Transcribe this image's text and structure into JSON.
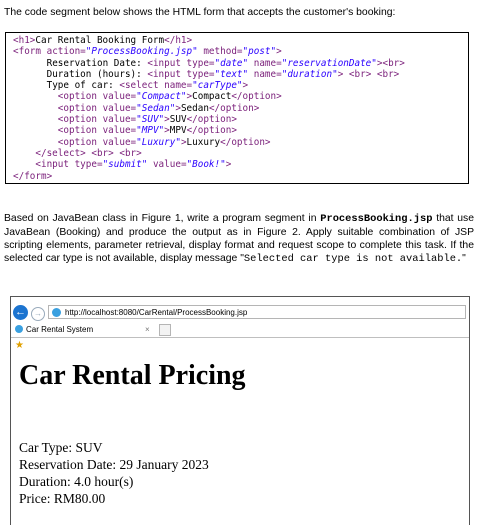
{
  "intro": "The code segment below shows the HTML form that accepts the customer's booking:",
  "code": {
    "line1": {
      "open": "<h1>",
      "text": "Car Rental Booking Form",
      "close": "</h1>"
    },
    "line2": {
      "form": "<form",
      "a1": " action=",
      "v1": "\"ProcessBooking.jsp\"",
      "a2": " method=",
      "v2": "\"post\"",
      "end": ">"
    },
    "line3": {
      "text": "Reservation Date: ",
      "tag": "<input",
      "a1": " type=",
      "v1": "\"date\"",
      "a2": " name=",
      "v2": "\"reservationDate\"",
      "end": "><br>"
    },
    "line4": {
      "text": "Duration (hours): ",
      "tag": "<input",
      "a1": " type=",
      "v1": "\"text\"",
      "a2": " name=",
      "v2": "\"duration\"",
      "end": "> <br> <br>"
    },
    "line5": {
      "text": "Type of car: ",
      "tag": "<select",
      "a1": " name=",
      "v1": "\"carType\"",
      "end": ">"
    },
    "options": [
      {
        "value": "\"Compact\"",
        "label": "Compact"
      },
      {
        "value": "\"Sedan\"",
        "label": "Sedan"
      },
      {
        "value": "\"SUV\"",
        "label": "SUV"
      },
      {
        "value": "\"MPV\"",
        "label": "MPV"
      },
      {
        "value": "\"Luxury\"",
        "label": "Luxury"
      }
    ],
    "line11": "</select> <br> <br>",
    "line12": {
      "tag": "<input",
      "a1": " type=",
      "v1": "\"submit\"",
      "a2": " value=",
      "v2": "\"Book!\"",
      "end": ">"
    },
    "line13": "</form>"
  },
  "task": {
    "p1": "Based on JavaBean class in Figure 1, write a program segment in",
    "file": "ProcessBooking.jsp",
    "p2": " that use JavaBean (Booking) and produce the output as in Figure 2. Apply suitable combination of JSP scripting elements, parameter retrieval, display format and request scope to complete this task. If the selected car type is not available, display message \"",
    "message": "Selected car type is not available.",
    "p3": "\""
  },
  "browser": {
    "url": "http://localhost:8080/CarRental/ProcessBooking.jsp",
    "tab_title": "Car Rental System",
    "tab_close": "×",
    "back_icon": "arrow-left-icon",
    "forward_icon": "arrow-right-icon",
    "favorites_icon": "star-icon",
    "heading": "Car Rental Pricing",
    "lines": [
      "Car Type: SUV",
      "Reservation Date: 29 January 2023",
      "Duration: 4.0 hour(s)",
      "Price: RM80.00"
    ]
  }
}
